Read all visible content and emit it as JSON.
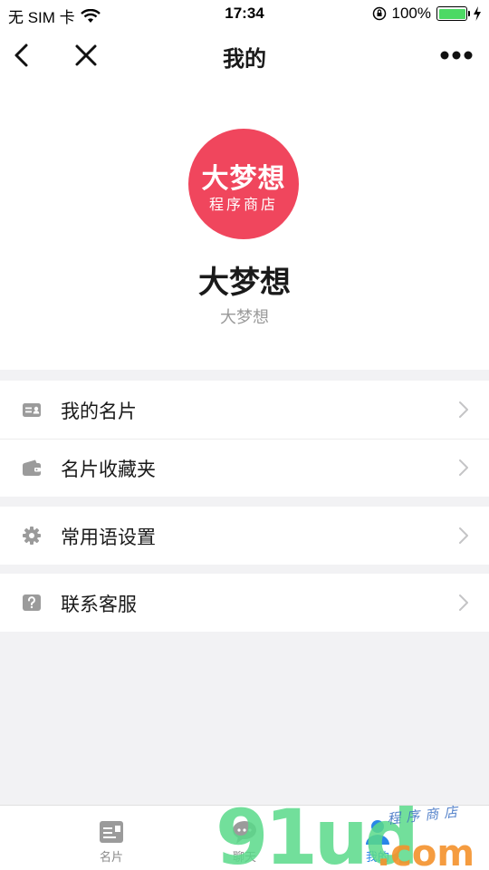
{
  "status_bar": {
    "carrier": "无 SIM 卡",
    "time": "17:34",
    "battery": "100%",
    "battery_level": 1.0,
    "icons": [
      "wifi-icon",
      "orientation-lock-icon",
      "battery-icon",
      "charging-icon"
    ]
  },
  "nav": {
    "title": "我的",
    "icons": [
      "back-icon",
      "close-icon",
      "more-icon"
    ]
  },
  "profile": {
    "avatar_line1": "大梦想",
    "avatar_line2": "程序商店",
    "avatar_color": "#f0465d",
    "name": "大梦想",
    "subtitle": "大梦想"
  },
  "menu": {
    "items": [
      {
        "label": "我的名片",
        "icon": "card-icon"
      },
      {
        "label": "名片收藏夹",
        "icon": "wallet-icon"
      },
      {
        "label": "常用语设置",
        "icon": "gear-icon"
      },
      {
        "label": "联系客服",
        "icon": "help-icon"
      }
    ]
  },
  "tabs": [
    {
      "label": "名片",
      "icon": "card-tab-icon",
      "active": false
    },
    {
      "label": "聊天",
      "icon": "chat-tab-icon",
      "active": false
    },
    {
      "label": "我的",
      "icon": "person-tab-icon",
      "active": true
    }
  ],
  "colors": {
    "accent": "#2a86e8",
    "background": "#f2f2f4",
    "icon_grey": "#9b9b9b"
  },
  "watermark": {
    "text_main": "91ud",
    "text_domain": ".com",
    "text_tag": "程序商店"
  }
}
